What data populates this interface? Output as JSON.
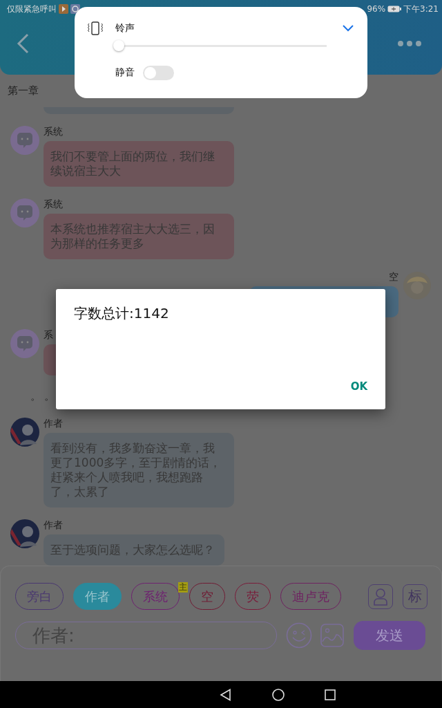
{
  "status_bar": {
    "carrier": "仅限紧急呼叫",
    "battery": "96%",
    "time": "下午3:21"
  },
  "chapter_title": "第一章",
  "messages": [
    {
      "kind": "clipped",
      "color": "#5d6368"
    },
    {
      "kind": "system",
      "sender": "系统",
      "text": "我们不要管上面的两位，我们继续说宿主大大",
      "color": "#6d5459"
    },
    {
      "kind": "system",
      "sender": "系统",
      "text": "本系统也推荐宿主大大选三，因为那样的任务更多",
      "color": "#6d5459"
    },
    {
      "kind": "self",
      "sender": "空",
      "color": "#4a6a80"
    },
    {
      "kind": "system",
      "sender": "系",
      "color": "#6d5459"
    },
    {
      "kind": "note",
      "text": "。 。"
    },
    {
      "kind": "author",
      "sender": "作者",
      "text": "看到没有，我多勤奋这一章，我更了1000多字，至于剧情的话，赶紧来个人喷我吧，我想跑路了，太累了",
      "color": "#5d6368"
    },
    {
      "kind": "author",
      "sender": "作者",
      "text": "至于选项问题，大家怎么选呢？",
      "color": "#5d6368"
    }
  ],
  "composer": {
    "roles": [
      {
        "label": "旁白",
        "color": "#4a3870",
        "selected": false
      },
      {
        "label": "作者",
        "color": "#2a8a9c",
        "selected": true
      },
      {
        "label": "系统",
        "color": "#6e2270",
        "selected": false
      },
      {
        "label": "空",
        "color": "#701c34",
        "selected": false,
        "badge": "主"
      },
      {
        "label": "荧",
        "color": "#7a1c3a",
        "selected": false
      },
      {
        "label": "迪卢克",
        "color": "#6e2260",
        "selected": false
      }
    ],
    "tag_button": "标",
    "placeholder": "作者:",
    "send": "发送"
  },
  "volume": {
    "label": "铃声",
    "level": 0,
    "mute_label": "静音",
    "mute_on": false
  },
  "dialog": {
    "title": "字数总计:1142",
    "button": "OK"
  }
}
